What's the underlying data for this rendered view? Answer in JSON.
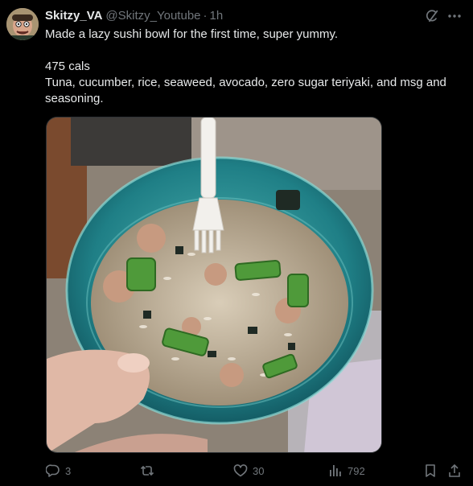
{
  "author": {
    "display_name": "Skitzy_VA",
    "handle": "@Skitzy_Youtube",
    "separator": "·",
    "time": "1h"
  },
  "tweet": {
    "line1": "Made a lazy sushi bowl for the first time, super yummy.",
    "line2": "475 cals",
    "line3": "Tuna, cucumber, rice, seaweed, avocado,  zero sugar teriyaki, and msg and seasoning."
  },
  "media": {
    "subject": "sushi-bowl-photo"
  },
  "actions": {
    "replies": "3",
    "reposts": "",
    "likes": "30",
    "views": "792"
  },
  "icons": {
    "grok": "grok-icon",
    "more": "more-icon",
    "reply": "reply-icon",
    "repost": "repost-icon",
    "like": "heart-icon",
    "views": "views-icon",
    "bookmark": "bookmark-icon",
    "share": "share-icon"
  },
  "colors": {
    "background": "#000000",
    "text": "#e7e9ea",
    "muted": "#71767b"
  }
}
